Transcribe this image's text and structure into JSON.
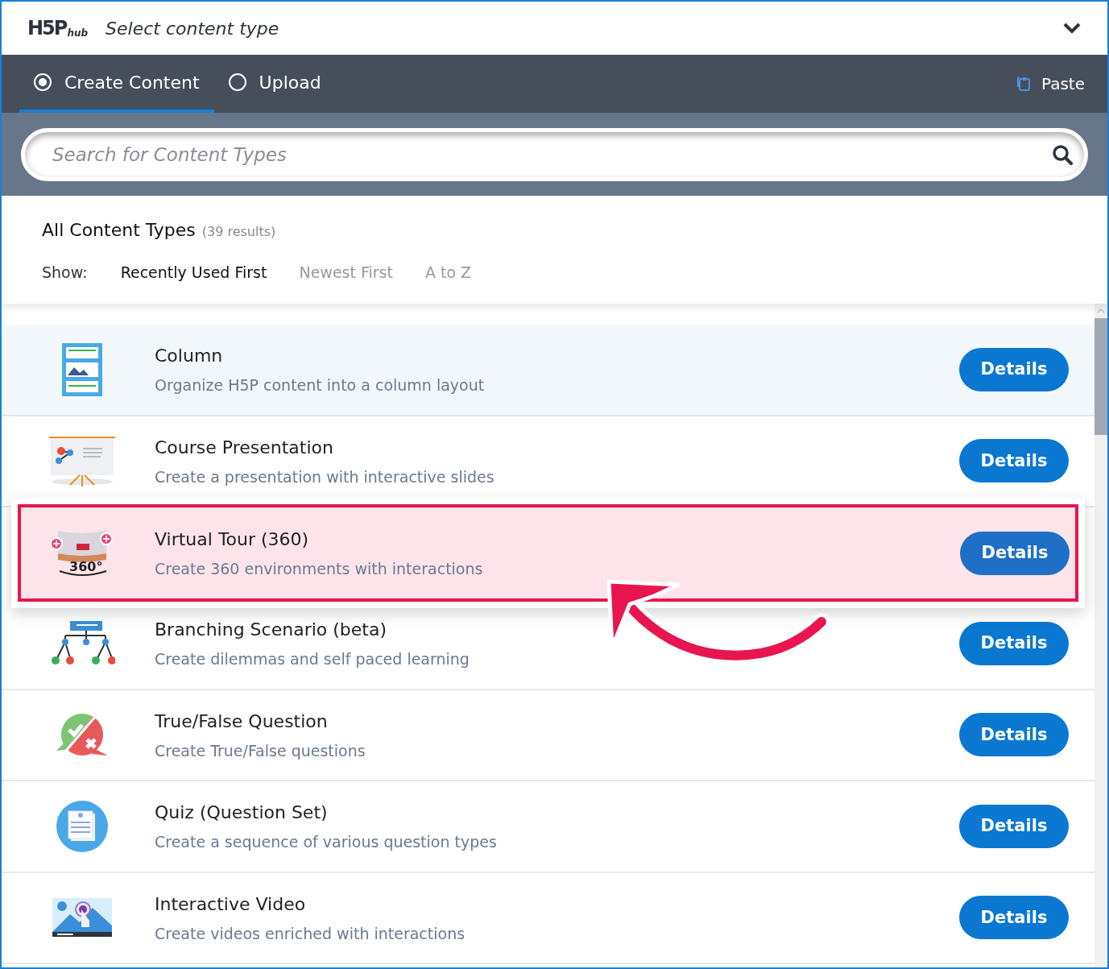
{
  "header": {
    "logo": "H5P",
    "logo_suffix": "hub",
    "title": "Select content type",
    "expanded": true
  },
  "tabs": [
    {
      "label": "Create Content",
      "selected": true
    },
    {
      "label": "Upload",
      "selected": false
    }
  ],
  "paste": {
    "label": "Paste"
  },
  "search": {
    "placeholder": "Search for Content Types"
  },
  "heading": {
    "title": "All Content Types",
    "count": "(39 results)"
  },
  "sort": {
    "label": "Show:",
    "options": [
      {
        "label": "Recently Used First",
        "selected": true
      },
      {
        "label": "Newest First",
        "selected": false
      },
      {
        "label": "A to Z",
        "selected": false
      }
    ]
  },
  "items": [
    {
      "kind": "column",
      "title": "Column",
      "description": "Organize H5P content into a column layout",
      "button": "Details",
      "selected": true,
      "highlighted": false
    },
    {
      "kind": "presentation",
      "title": "Course Presentation",
      "description": "Create a presentation with interactive slides",
      "button": "Details",
      "selected": false,
      "highlighted": false
    },
    {
      "kind": "tour",
      "icon_text": "360°",
      "title": "Virtual Tour (360)",
      "description": "Create 360 environments with interactions",
      "button": "Details",
      "selected": false,
      "highlighted": true
    },
    {
      "kind": "branching",
      "title": "Branching Scenario (beta)",
      "description": "Create dilemmas and self paced learning",
      "button": "Details",
      "selected": false,
      "highlighted": false
    },
    {
      "kind": "truefalse",
      "title": "True/False Question",
      "description": "Create True/False questions",
      "button": "Details",
      "selected": false,
      "highlighted": false
    },
    {
      "kind": "quiz",
      "title": "Quiz (Question Set)",
      "description": "Create a sequence of various question types",
      "button": "Details",
      "selected": false,
      "highlighted": false
    },
    {
      "kind": "video",
      "title": "Interactive Video",
      "description": "Create videos enriched with interactions",
      "button": "Details",
      "selected": false,
      "highlighted": false
    }
  ]
}
